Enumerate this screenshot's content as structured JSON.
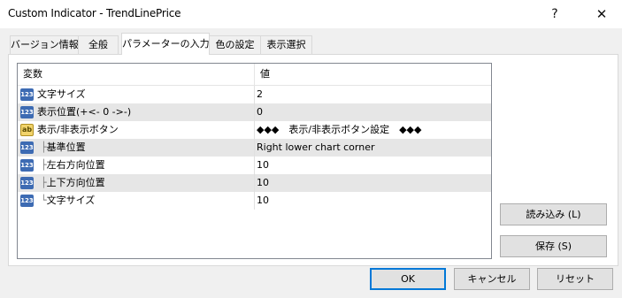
{
  "window": {
    "title": "Custom Indicator - TrendLinePrice",
    "help_label": "?",
    "close_label": "✕"
  },
  "tabs": [
    {
      "label": "バージョン情報",
      "active": false
    },
    {
      "label": "全般",
      "active": false
    },
    {
      "label": "パラメーターの入力",
      "active": true
    },
    {
      "label": "色の設定",
      "active": false
    },
    {
      "label": "表示選択",
      "active": false
    }
  ],
  "grid": {
    "headers": {
      "variable": "変数",
      "value": "値"
    },
    "rows": [
      {
        "icon": "numeric-icon",
        "icon_text": "123",
        "prefix": "",
        "name": "文字サイズ",
        "value": "2"
      },
      {
        "icon": "numeric-icon",
        "icon_text": "123",
        "prefix": "",
        "name": "表示位置(+<- 0 ->-)",
        "value": "0"
      },
      {
        "icon": "string-icon",
        "icon_text": "ab",
        "prefix": "",
        "name": "表示/非表示ボタン",
        "value": "◆◆◆　表示/非表示ボタン設定　◆◆◆"
      },
      {
        "icon": "numeric-icon",
        "icon_text": "123",
        "prefix": "├",
        "name": "基準位置",
        "value": "Right lower chart corner"
      },
      {
        "icon": "numeric-icon",
        "icon_text": "123",
        "prefix": "├",
        "name": "左右方向位置",
        "value": "10"
      },
      {
        "icon": "numeric-icon",
        "icon_text": "123",
        "prefix": "├",
        "name": "上下方向位置",
        "value": "10"
      },
      {
        "icon": "numeric-icon",
        "icon_text": "123",
        "prefix": "└",
        "name": "文字サイズ",
        "value": "10"
      }
    ]
  },
  "side_buttons": {
    "load": "読み込み (L)",
    "save": "保存 (S)"
  },
  "footer_buttons": {
    "ok": "OK",
    "cancel": "キャンセル",
    "reset": "リセット"
  }
}
